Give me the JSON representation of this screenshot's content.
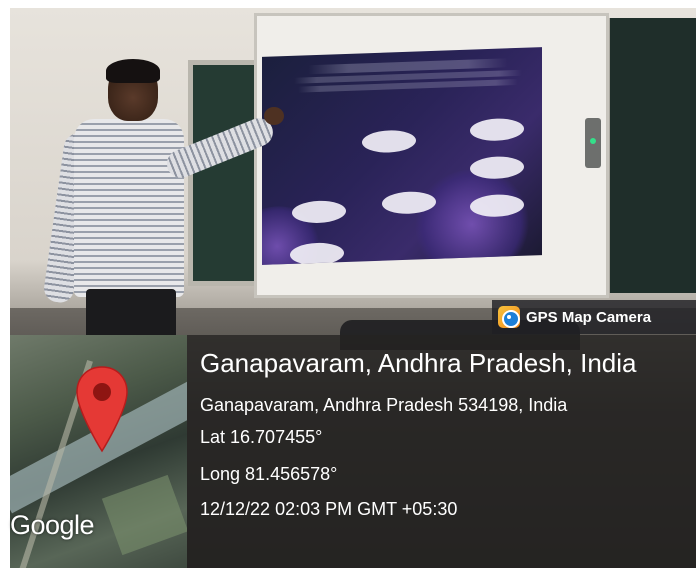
{
  "overlay": {
    "app_label": "GPS Map Camera",
    "app_icon": "gps-map-camera-icon",
    "map_provider": "Google",
    "pin_icon": "map-pin-icon",
    "location_title": "Ganapavaram, Andhra Pradesh, India",
    "address": "Ganapavaram, Andhra Pradesh 534198, India",
    "latitude": "Lat 16.707455°",
    "longitude": "Long 81.456578°",
    "timestamp": "12/12/22 02:03 PM GMT +05:30",
    "colors": {
      "pin": "#e53935",
      "panel": "#242221",
      "text": "#ffffff"
    }
  }
}
